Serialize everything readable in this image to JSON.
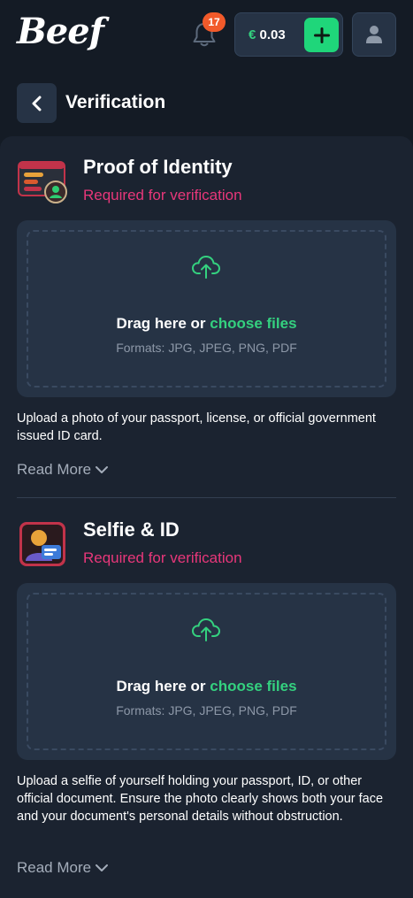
{
  "header": {
    "logo": "Beef",
    "notifications_count": "17",
    "balance_currency": "€",
    "balance_amount": "0.03"
  },
  "page": {
    "title": "Verification"
  },
  "sections": [
    {
      "title": "Proof of Identity",
      "status": "Required for verification",
      "drag_text": "Drag here or ",
      "choose_files": "choose files",
      "formats": "Formats: JPG, JPEG, PNG, PDF",
      "description": "Upload a photo of your passport, license, or official government issued ID card.",
      "read_more": "Read More"
    },
    {
      "title": "Selfie & ID",
      "status": "Required for verification",
      "drag_text": "Drag here or ",
      "choose_files": "choose files",
      "formats": "Formats: JPG, JPEG, PNG, PDF",
      "description": "Upload a selfie of yourself holding your passport, ID, or other official document. Ensure the photo clearly shows both your face and your document's personal details without obstruction.",
      "read_more": "Read More"
    }
  ],
  "colors": {
    "background": "#141b25",
    "panel": "#1b2330",
    "accent_green": "#34d17f",
    "required_pink": "#e8377a",
    "badge_orange": "#f25a2a"
  },
  "icons": {
    "bell": "bell-icon",
    "plus": "plus-icon",
    "user": "user-icon",
    "back": "chevron-left-icon",
    "upload": "cloud-upload-icon",
    "chevron": "chevron-down-icon"
  }
}
